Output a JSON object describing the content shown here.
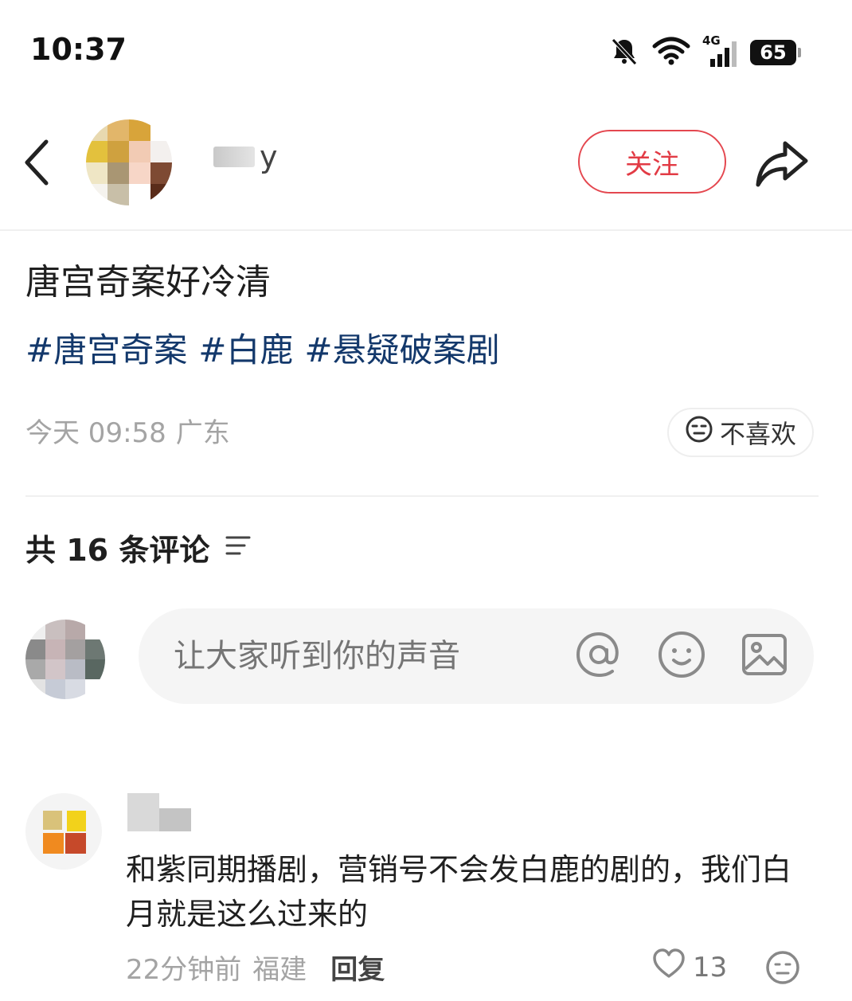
{
  "status_bar": {
    "time": "10:37",
    "network": "4G",
    "battery": "65",
    "icons": [
      "mute-bell-icon",
      "wifi-icon",
      "cellular-signal-icon",
      "battery-icon"
    ]
  },
  "header": {
    "username_suffix": "y",
    "follow_label": "关注",
    "icons": [
      "back-arrow-icon",
      "share-arrow-icon"
    ]
  },
  "post": {
    "title": "唐宫奇案好冷清",
    "tags": [
      "#唐宫奇案",
      "#白鹿",
      "#悬疑破案剧"
    ],
    "date": "今天 09:58",
    "location": "广东",
    "dislike_label": "不喜欢"
  },
  "comments_section": {
    "count_label": "共 16 条评论",
    "input_placeholder": "让大家听到你的声音",
    "input_icons": [
      "at-icon",
      "emoji-icon",
      "image-icon"
    ]
  },
  "comments": [
    {
      "text": "和紫同期播剧，营销号不会发白鹿的剧的，我们白月就是这么过来的",
      "time": "22分钟前",
      "location": "福建",
      "reply_label": "回复",
      "likes": "13"
    }
  ],
  "colors": {
    "accent_red": "#e23b45",
    "tag_blue": "#13386b",
    "meta_gray": "#a4a4a4"
  }
}
